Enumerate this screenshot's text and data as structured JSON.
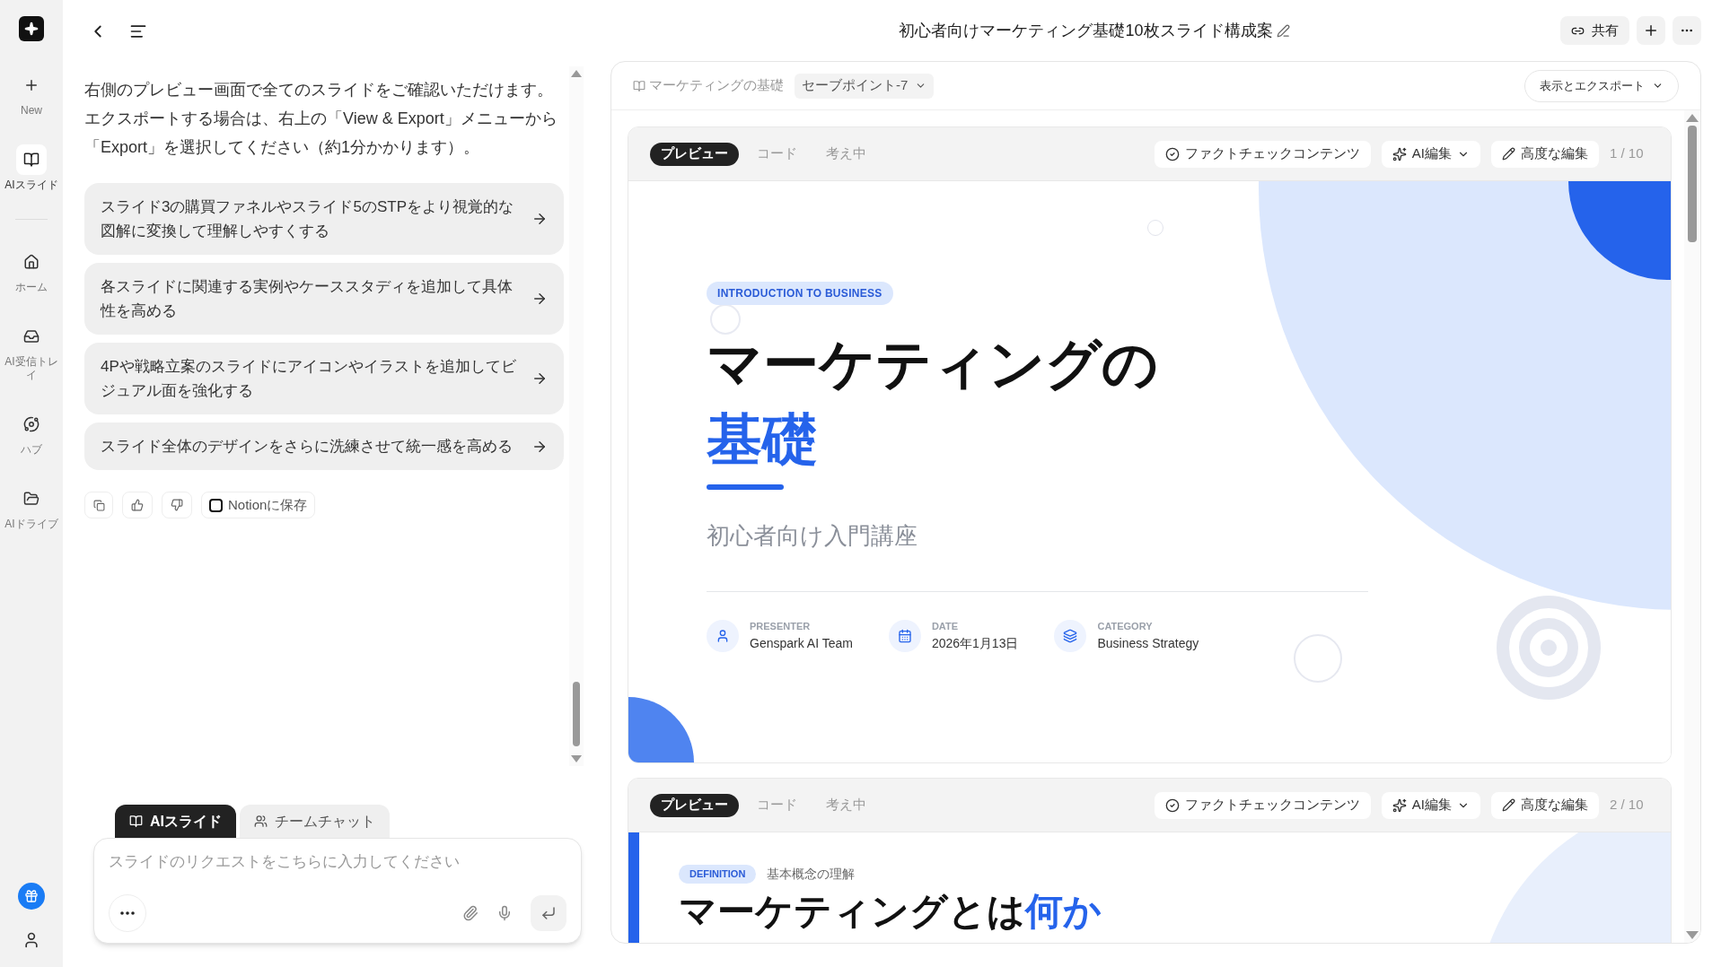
{
  "sidebar": {
    "items": [
      {
        "label": "New",
        "selected": false
      },
      {
        "label": "AIスライド",
        "selected": true
      },
      {
        "label": "ホーム",
        "selected": false
      },
      {
        "label": "AI受信トレイ",
        "selected": false
      },
      {
        "label": "ハブ",
        "selected": false
      },
      {
        "label": "AIドライブ",
        "selected": false
      }
    ]
  },
  "chat": {
    "message": "右側のプレビュー画面で全てのスライドをご確認いただけます。エクスポートする場合は、右上の「View & Export」メニューから「Export」を選択してください（約1分かかります）。",
    "suggestions": [
      "スライド3の購買ファネルやスライド5のSTPをより視覚的な図解に変換して理解しやすくする",
      "各スライドに関連する実例やケーススタディを追加して具体性を高める",
      "4Pや戦略立案のスライドにアイコンやイラストを追加してビジュアル面を強化する",
      "スライド全体のデザインをさらに洗練させて統一感を高める"
    ],
    "save_label": "Notionに保存",
    "composer_tabs": [
      {
        "label": "AIスライド",
        "selected": true
      },
      {
        "label": "チームチャット",
        "selected": false
      }
    ],
    "placeholder": "スライドのリクエストをこちらに入力してください"
  },
  "header": {
    "title": "初心者向けマーケティング基礎10枚スライド構成案",
    "share": "共有"
  },
  "panel": {
    "breadcrumb": "マーケティングの基礎",
    "savepoint": "セーブポイント-7",
    "export": "表示とエクスポート",
    "slides": [
      {
        "kind": "title",
        "tabs": [
          {
            "label": "プレビュー",
            "selected": true
          },
          {
            "label": "コード",
            "selected": false
          },
          {
            "label": "考え中",
            "selected": false
          }
        ],
        "fact_check": "ファクトチェックコンテンツ",
        "ai_edit": "AI編集",
        "advanced_edit": "高度な編集",
        "page": "1 / 10",
        "badge": "INTRODUCTION TO BUSINESS",
        "title": "マーケティングの",
        "title_highlight": "基礎",
        "subtitle": "初心者向け入門講座",
        "meta": [
          {
            "label": "PRESENTER",
            "value": "Genspark AI Team"
          },
          {
            "label": "DATE",
            "value": "2026年1月13日"
          },
          {
            "label": "CATEGORY",
            "value": "Business Strategy"
          }
        ]
      },
      {
        "kind": "definition",
        "tabs": [
          {
            "label": "プレビュー",
            "selected": true
          },
          {
            "label": "コード",
            "selected": false
          },
          {
            "label": "考え中",
            "selected": false
          }
        ],
        "fact_check": "ファクトチェックコンテンツ",
        "ai_edit": "AI編集",
        "advanced_edit": "高度な編集",
        "page": "2 / 10",
        "badge": "DEFINITION",
        "caption": "基本概念の理解",
        "title": "マーケティングとは",
        "title_highlight": "何か"
      }
    ]
  }
}
